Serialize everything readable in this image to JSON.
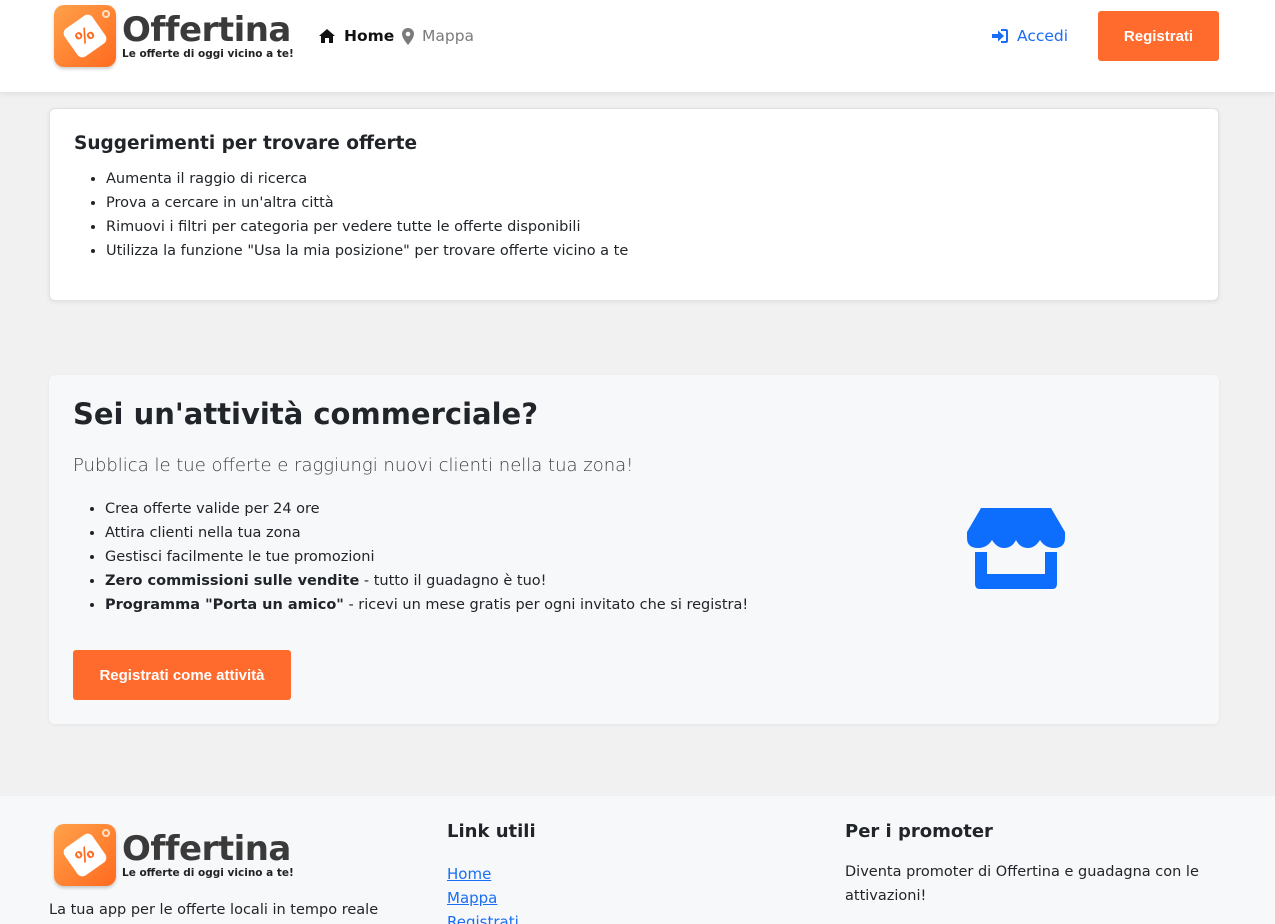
{
  "header": {
    "logo": {
      "brand": "Offertina",
      "slogan": "Le offerte di oggi vicino a te!",
      "symbol": "%"
    },
    "nav": [
      {
        "label": "Home",
        "icon": "home-icon",
        "active": true
      },
      {
        "label": "Mappa",
        "icon": "map-marker-icon",
        "active": false
      }
    ],
    "login_label": "Accedi",
    "register_label": "Registrati"
  },
  "tips": {
    "title": "Suggerimenti per trovare offerte",
    "items": [
      "Aumenta il raggio di ricerca",
      "Prova a cercare in un'altra città",
      "Rimuovi i filtri per categoria per vedere tutte le offerte disponibili",
      "Utilizza la funzione \"Usa la mia posizione\" per trovare offerte vicino a te"
    ]
  },
  "business": {
    "title": "Sei un'attività commerciale?",
    "lead": "Pubblica le tue offerte e raggiungi nuovi clienti nella tua zona!",
    "items": [
      {
        "bold": "",
        "text": "Crea offerte valide per 24 ore"
      },
      {
        "bold": "",
        "text": "Attira clienti nella tua zona"
      },
      {
        "bold": "",
        "text": "Gestisci facilmente le tue promozioni"
      },
      {
        "bold": "Zero commissioni sulle vendite",
        "text": " - tutto il guadagno è tuo!"
      },
      {
        "bold": "Programma \"Porta un amico\"",
        "text": " - ricevi un mese gratis per ogni invitato che si registra!"
      }
    ],
    "cta_label": "Registrati come attività",
    "icon": "store-icon"
  },
  "footer": {
    "logo": {
      "brand": "Offertina",
      "slogan": "Le offerte di oggi vicino a te!",
      "symbol": "%"
    },
    "tagline": "La tua app per le offerte locali in tempo reale",
    "links_title": "Link utili",
    "links": [
      "Home",
      "Mappa",
      "Registrati"
    ],
    "promoter_title": "Per i promoter",
    "promoter_text": "Diventa promoter di Offertina e guadagna con le attivazioni!"
  },
  "colors": {
    "accent": "#ff6a2d",
    "link": "#1a6ef5",
    "page_bg": "#f1f1f1",
    "text": "#212529"
  }
}
